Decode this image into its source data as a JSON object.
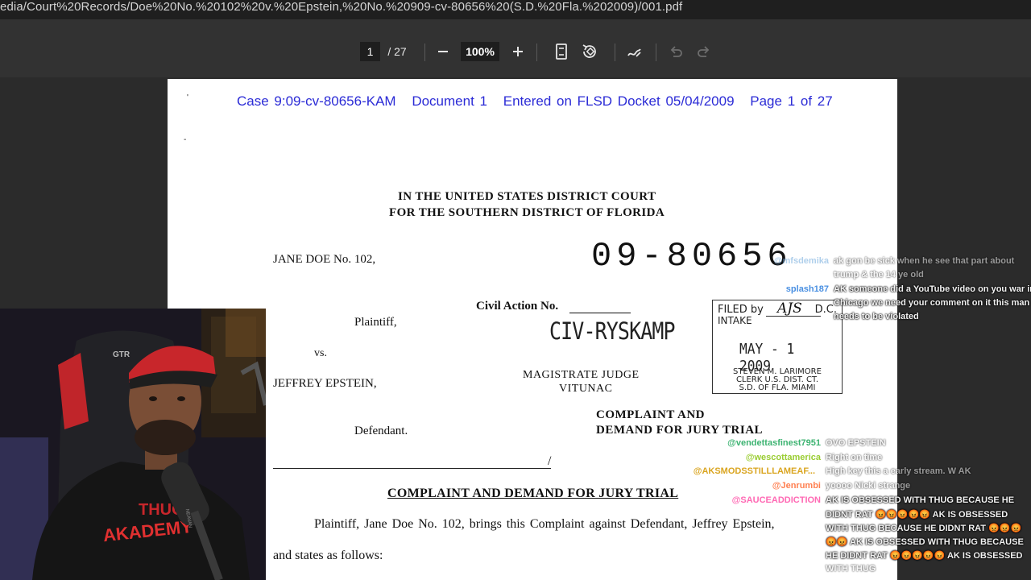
{
  "browser": {
    "url": "edia/Court%20Records/Doe%20No.%20102%20v.%20Epstein,%20No.%20909-cv-80656%20(S.D.%20Fla.%202009)/001.pdf"
  },
  "pdf_toolbar": {
    "current_page": "1",
    "total_pages": "/ 27",
    "zoom": "100%"
  },
  "document": {
    "header": {
      "case": "Case 9:09-cv-80656-KAM",
      "doc": "Document 1",
      "entered": "Entered on FLSD Docket 05/04/2009",
      "page": "Page 1 of 27"
    },
    "court_line1": "IN THE UNITED STATES DISTRICT COURT",
    "court_line2": "FOR THE SOUTHERN DISTRICT OF FLORIDA",
    "plaintiff_name": "JANE DOE No. 102,",
    "case_number_stamp": "09-80656",
    "civil_action_label": "Civil Action No.",
    "plaintiff_role": "Plaintiff,",
    "civ_stamp": "CIV-RYSKAMP",
    "vs": "vs.",
    "defendant_name": "JEFFREY EPSTEIN,",
    "magistrate_line1": "MAGISTRATE JUDGE",
    "magistrate_line2": "VITUNAC",
    "filed_stamp": {
      "filed_by": "FILED by",
      "initials": "AJS",
      "dc": "D.C.",
      "intake": "INTAKE",
      "date": "MAY - 1 2009",
      "clerk1": "STEVEN M. LARIMORE",
      "clerk2": "CLERK U.S. DIST. CT.",
      "clerk3": "S.D. OF FLA. MIAMI"
    },
    "complaint_line1": "COMPLAINT AND",
    "complaint_line2": "DEMAND FOR JURY TRIAL",
    "defendant_role": "Defendant.",
    "slash": "/",
    "title": "COMPLAINT AND DEMAND FOR JURY TRIAL",
    "body_line1": "Plaintiff, Jane Doe No. 102, brings this Complaint against Defendant, Jeffrey Epstein,",
    "body_line2": "and states as follows:"
  },
  "webcam": {
    "shirt_text1": "THUG",
    "shirt_text2": "AKADEMY",
    "chair_brand": "GTR",
    "mic_brand": "NEAVAN"
  },
  "chat": {
    "messages": [
      {
        "user": "@mfsdemika",
        "text": "ak gon be sick when he see that part about",
        "text2": "trump & the 14 ye old",
        "color": "#6fa8dc"
      },
      {
        "user": "splash187",
        "text": "AK someone did a YouTube video on you war in",
        "text2": "Chicago we need your comment on it this man",
        "text3": "needs to be violated",
        "color": "#4a90e2"
      },
      {
        "user": "@vendettasfinest7951",
        "text": "OVO EPSTEIN",
        "color": "#3cb371"
      },
      {
        "user": "@wescottamerica",
        "text": "Right on time",
        "color": "#9acd32"
      },
      {
        "user": "@AKSMODSSTILLLAMEAF...",
        "text": "High key this a early stream. W AK",
        "color": "#daa520"
      },
      {
        "user": "@Jenrumbi",
        "text": "yoooo Nicki strange",
        "color": "#ff7f50"
      },
      {
        "user": "@SAUCEADDICTION",
        "text": "AK IS OBSESSED WITH THUG BECAUSE HE",
        "text2": "DIDNT RAT 😡😡😡😡😡 AK IS OBSESSED",
        "text3": "WITH THUG BECAUSE HE DIDNT RAT 😡😡😡",
        "text4": "😡😡 AK IS OBSESSED WITH THUG BECAUSE",
        "text5": "HE DIDNT RAT 😡😡😡😡😡 AK IS OBSESSED",
        "text6": "WITH THUG",
        "color": "#ff69b4"
      }
    ]
  }
}
